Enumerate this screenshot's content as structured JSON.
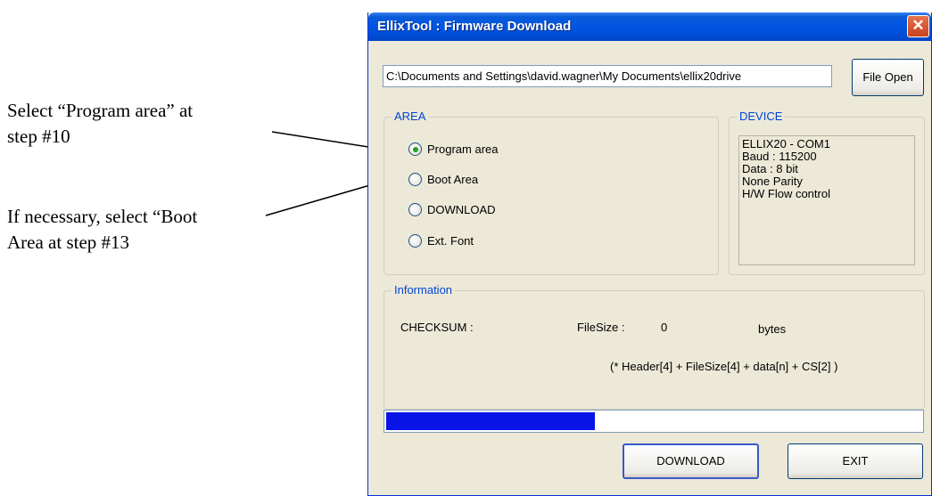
{
  "annotations": {
    "note1": "Select “Program area” at\nstep #10",
    "note2": "If necessary, select “Boot\nArea at step #13"
  },
  "window": {
    "title": "EllixTool : Firmware Download",
    "close_glyph": "✕"
  },
  "file": {
    "path_value": "C:\\Documents and Settings\\david.wagner\\My Documents\\ellix20drive",
    "open_label": "File Open"
  },
  "area": {
    "label": "AREA",
    "options": [
      {
        "label": "Program area",
        "selected": true
      },
      {
        "label": "Boot Area",
        "selected": false
      },
      {
        "label": "DOWNLOAD",
        "selected": false
      },
      {
        "label": "Ext. Font",
        "selected": false
      }
    ]
  },
  "device": {
    "label": "DEVICE",
    "lines": [
      "ELLIX20 - COM1",
      "Baud : 115200",
      "Data : 8 bit",
      "None Parity",
      "H/W Flow control"
    ]
  },
  "information": {
    "label": "Information",
    "checksum_label": "CHECKSUM :",
    "filesize_label": "FileSize :",
    "filesize_value": "0",
    "filesize_unit": "bytes",
    "formula": "(* Header[4] + FileSize[4] + data[n] + CS[2] )"
  },
  "progress": {
    "fraction": 0.39,
    "color": "#0a14e6"
  },
  "buttons": {
    "download": "DOWNLOAD",
    "exit": "EXIT"
  },
  "icons": {
    "selected_radio": "radio-selected-icon",
    "unselected_radio": "radio-unselected-icon"
  }
}
